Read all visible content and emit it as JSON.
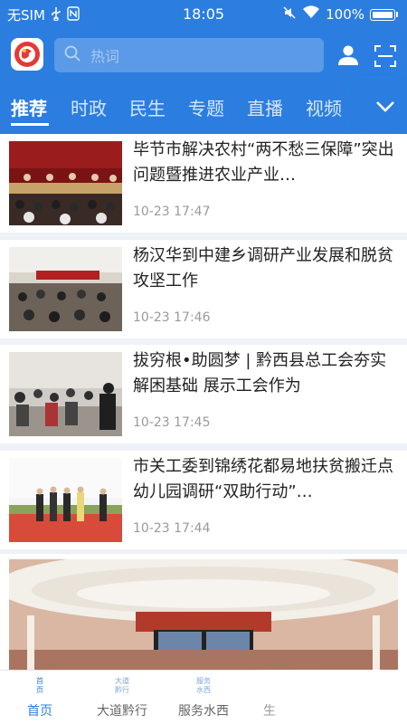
{
  "status_bar": {
    "carrier": "无SIM",
    "time": "18:05",
    "battery": "100%"
  },
  "search": {
    "placeholder": "热词"
  },
  "tabs": [
    "推荐",
    "时政",
    "民生",
    "专题",
    "直播",
    "视频"
  ],
  "news": [
    {
      "title": "毕节市解决农村“两不愁三保障”突出问题暨推进农业产业…",
      "time": "10-23 17:47"
    },
    {
      "title": "杨汉华到中建乡调研产业发展和脱贫攻坚工作",
      "time": "10-23 17:46"
    },
    {
      "title": "拔穷根•助圆梦 | 黔西县总工会夯实解困基础 展示工会作为",
      "time": "10-23 17:45"
    },
    {
      "title": "市关工委到锦绣花都易地扶贫搬迁点幼儿园调研“双助行动”…",
      "time": "10-23 17:44"
    }
  ],
  "bottom_nav": [
    {
      "label": "首页",
      "icon_text": [
        "首",
        "页"
      ]
    },
    {
      "label": "大道黔行",
      "icon_text": [
        "大道",
        "黔行"
      ]
    },
    {
      "label": "服务水西",
      "icon_text": [
        "服务",
        "水西"
      ]
    },
    {
      "label": "生"
    }
  ],
  "colors": {
    "header_blue": "#2b7ee0",
    "text": "#222222",
    "meta": "#9a9a9a"
  },
  "icons": [
    "usb-icon",
    "nfc-icon",
    "mute-icon",
    "wifi-icon",
    "battery-icon",
    "app-logo-icon",
    "search-icon",
    "user-icon",
    "scan-icon",
    "chevron-down-icon"
  ]
}
